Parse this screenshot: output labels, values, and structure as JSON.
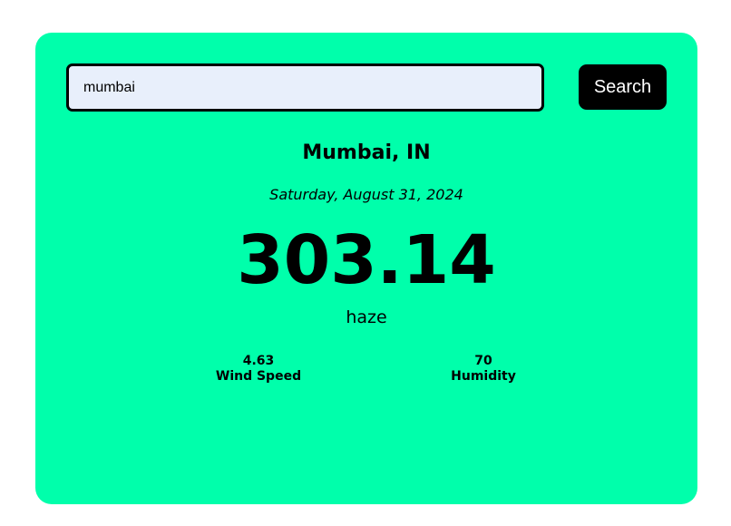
{
  "search": {
    "value": "mumbai",
    "button_label": "Search"
  },
  "weather": {
    "city": "Mumbai, IN",
    "date": "Saturday, August 31, 2024",
    "temperature": "303.14",
    "condition": "haze",
    "wind_speed": {
      "value": "4.63",
      "label": "Wind Speed"
    },
    "humidity": {
      "value": "70",
      "label": "Humidity"
    }
  },
  "colors": {
    "card_background": "#00ffab",
    "input_background": "#e8effb",
    "button_background": "#000000",
    "button_text": "#ffffff"
  }
}
